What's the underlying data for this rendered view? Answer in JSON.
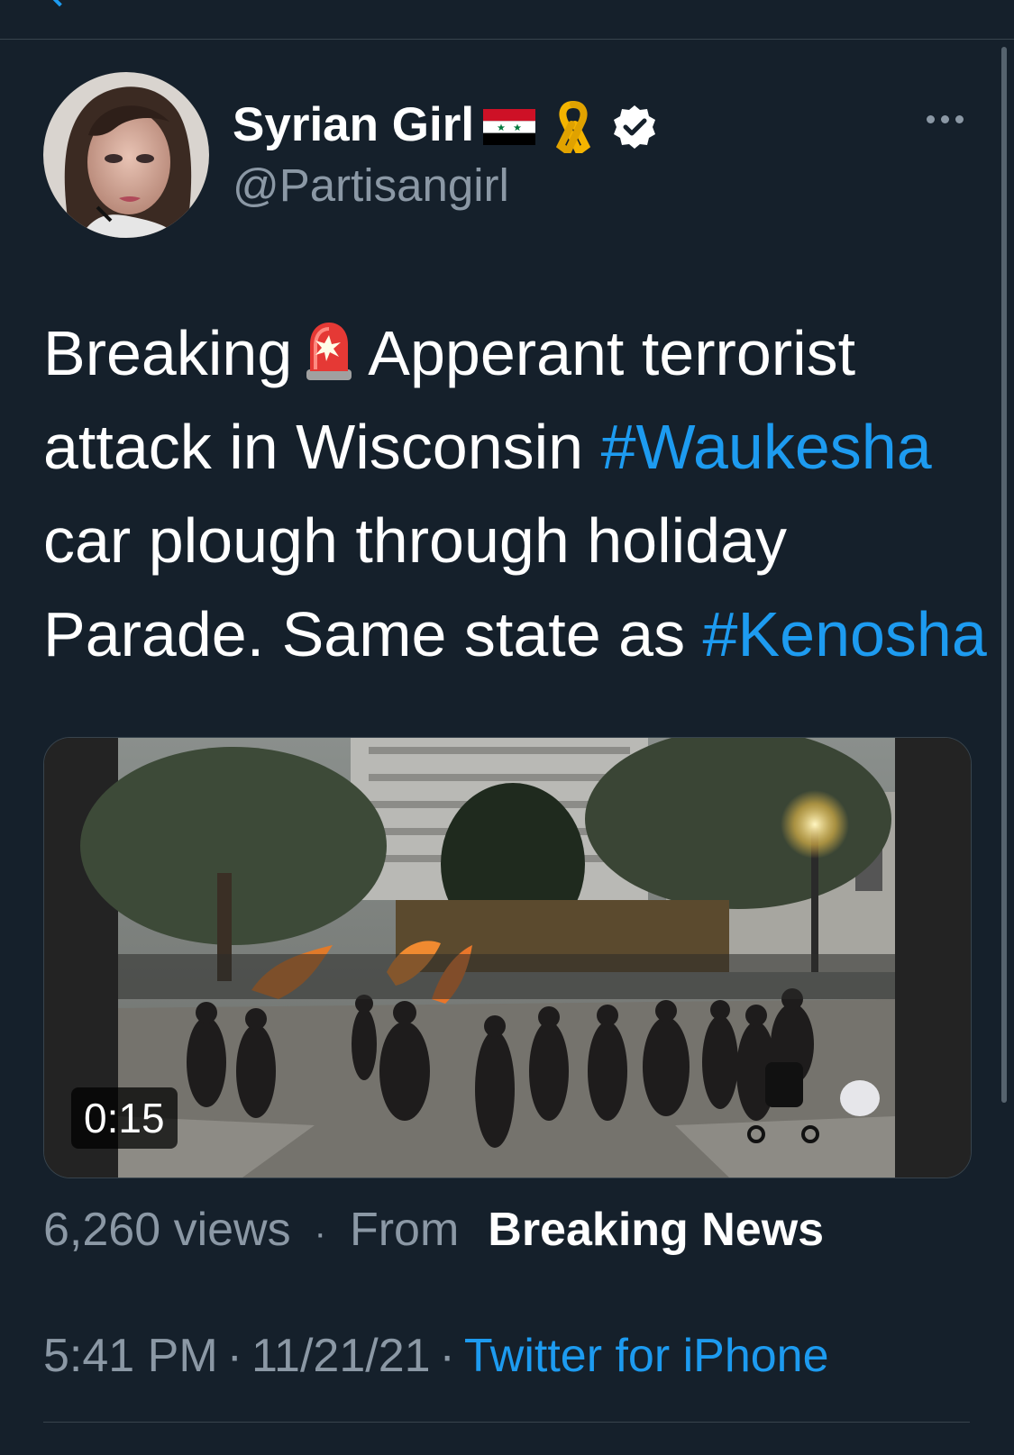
{
  "author": {
    "display_name": "Syrian Girl",
    "handle": "@Partisangirl",
    "badges": [
      "syria-flag-icon",
      "yellow-ribbon-icon",
      "verified-badge-icon"
    ]
  },
  "tweet": {
    "lines": [
      {
        "before": "Breaking",
        "after": "Apperant terrorist"
      },
      {
        "text": "attack in Wisconsin ",
        "hashtag": "#Waukesha"
      },
      {
        "text": "car plough through holiday"
      },
      {
        "text": "Parade. Same state as ",
        "hashtag": "#Kenosha"
      }
    ]
  },
  "media": {
    "duration": "0:15"
  },
  "meta": {
    "views": "6,260 views",
    "separator": "·",
    "from_label": "From",
    "channel": "Breaking News"
  },
  "footer": {
    "time": "5:41 PM",
    "date": "11/21/21",
    "separator": "·",
    "source": "Twitter for iPhone"
  },
  "colors": {
    "background": "#15202b",
    "link": "#1d9bf0",
    "secondary_text": "#8b98a5",
    "divider": "#38444d"
  }
}
